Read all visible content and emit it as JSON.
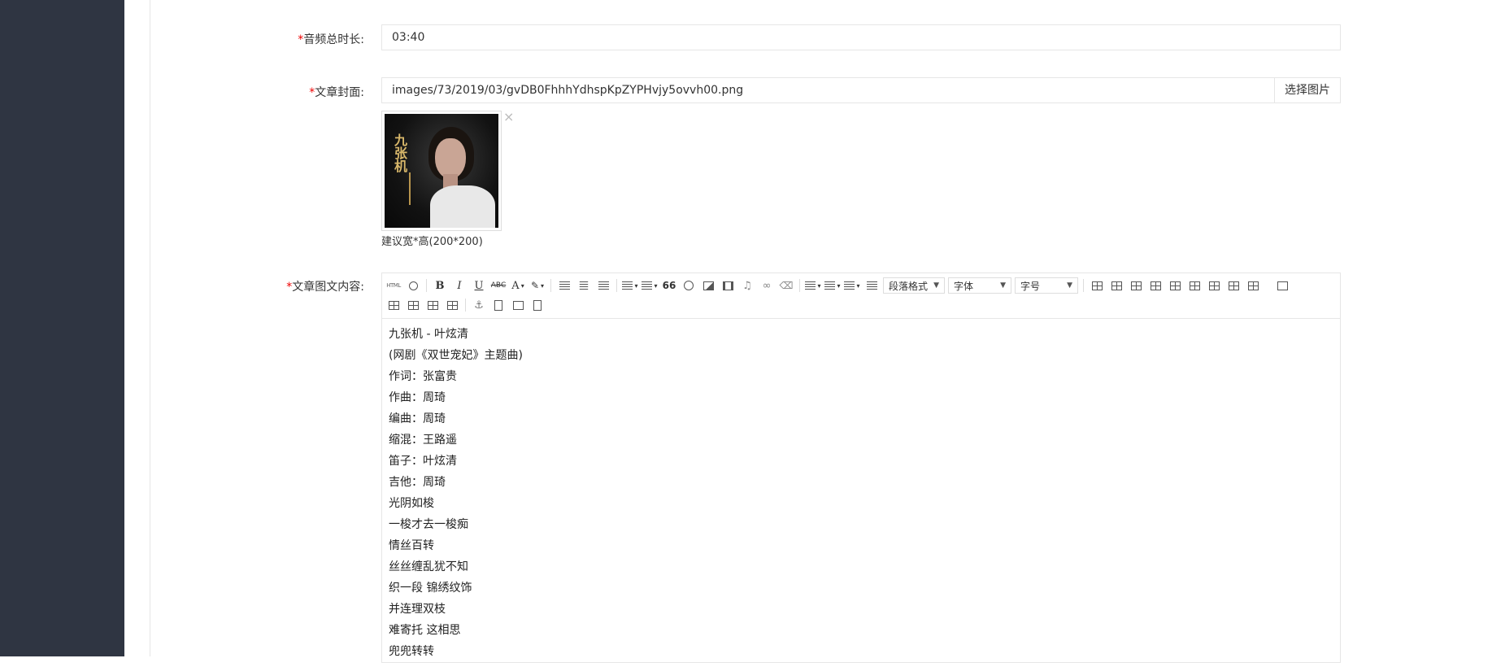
{
  "form": {
    "duration": {
      "required_mark": "*",
      "label": "音频总时长:",
      "value": "03:40"
    },
    "cover": {
      "required_mark": "*",
      "label": "文章封面:",
      "path_value": "images/73/2019/03/gvDB0FhhhYdhspKpZYPHvjy5ovvh00.png",
      "choose_button": "选择图片",
      "close_glyph": "×",
      "thumb_calligraphy": "九张机",
      "size_hint": "建议宽*高(200*200)"
    },
    "content": {
      "required_mark": "*",
      "label": "文章图文内容:",
      "toolbar": {
        "html_label": "HTML",
        "bold": "B",
        "italic": "I",
        "underline": "U",
        "strike": "ABC",
        "font_color": "A",
        "quote": "66",
        "paragraph_select": "段落格式",
        "font_select": "字体",
        "size_select": "字号"
      },
      "lines": [
        "九张机 - 叶炫清",
        "(网剧《双世宠妃》主题曲)",
        "作词：张富贵",
        "作曲：周琦",
        "编曲：周琦",
        "缩混：王路遥",
        "笛子：叶炫清",
        "吉他：周琦",
        "光阴如梭",
        "一梭才去一梭痴",
        "情丝百转",
        "丝丝缠乱犹不知",
        "织一段 锦绣纹饰",
        "并连理双枝",
        "难寄托 这相思",
        "兜兜转转"
      ]
    }
  }
}
